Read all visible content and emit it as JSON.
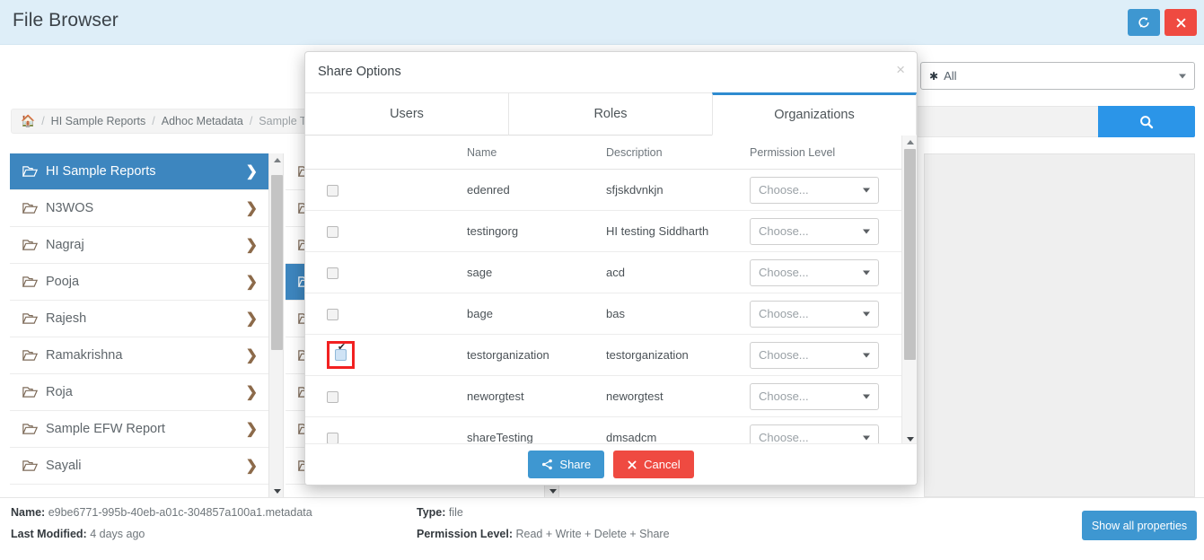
{
  "header": {
    "title": "File Browser",
    "refresh_icon": "refresh-icon",
    "close_icon": "close-icon",
    "accent_blue": "#3e97d1",
    "accent_red": "#ef4a41",
    "background": "#deeef8"
  },
  "breadcrumb": {
    "home_icon": "home-icon",
    "items": [
      "HI Sample Reports",
      "Adhoc Metadata",
      "Sample Travel M"
    ],
    "separator": "/"
  },
  "filter": {
    "icon": "asterisk-icon",
    "value": "All",
    "caret_icon": "chevron-down-icon"
  },
  "search": {
    "value": "",
    "placeholder": "",
    "button_icon": "search-icon"
  },
  "tree_column_1": {
    "items": [
      {
        "label": "HI Sample Reports",
        "active": true
      },
      {
        "label": "N3WOS",
        "active": false
      },
      {
        "label": "Nagraj",
        "active": false
      },
      {
        "label": "Pooja",
        "active": false
      },
      {
        "label": "Rajesh",
        "active": false
      },
      {
        "label": "Ramakrishna",
        "active": false
      },
      {
        "label": "Roja",
        "active": false
      },
      {
        "label": "Sample EFW Report",
        "active": false
      },
      {
        "label": "Sayali",
        "active": false
      }
    ],
    "folder_icon": "folder-icon",
    "chevron_icon": "chevron-right-icon"
  },
  "tree_column_2": {
    "items": [
      {
        "label": "",
        "active": false
      },
      {
        "label": "",
        "active": false
      },
      {
        "label": "",
        "active": false
      },
      {
        "label": "",
        "active": true
      },
      {
        "label": "",
        "active": false
      },
      {
        "label": "",
        "active": false
      },
      {
        "label": "",
        "active": false
      },
      {
        "label": "",
        "active": false
      },
      {
        "label": "",
        "active": false
      }
    ]
  },
  "modal": {
    "title": "Share Options",
    "close_icon": "close-icon",
    "tabs": [
      {
        "label": "Users",
        "active": false
      },
      {
        "label": "Roles",
        "active": false
      },
      {
        "label": "Organizations",
        "active": true
      }
    ],
    "active_tab_color": "#2e8bd0",
    "table": {
      "columns": [
        "",
        "Name",
        "Description",
        "Permission Level"
      ],
      "rows": [
        {
          "checked": false,
          "highlighted": false,
          "name": "edenred",
          "description": "sfjskdvnkjn",
          "permission": "Choose..."
        },
        {
          "checked": false,
          "highlighted": false,
          "name": "testingorg",
          "description": "HI testing Siddharth",
          "permission": "Choose..."
        },
        {
          "checked": false,
          "highlighted": false,
          "name": "sage",
          "description": "acd",
          "permission": "Choose..."
        },
        {
          "checked": false,
          "highlighted": false,
          "name": "bage",
          "description": "bas",
          "permission": "Choose..."
        },
        {
          "checked": true,
          "highlighted": true,
          "name": "testorganization",
          "description": "testorganization",
          "permission": "Choose..."
        },
        {
          "checked": false,
          "highlighted": false,
          "name": "neworgtest",
          "description": "neworgtest",
          "permission": "Choose..."
        },
        {
          "checked": false,
          "highlighted": false,
          "name": "shareTesting",
          "description": "dmsadcm",
          "permission": "Choose..."
        }
      ],
      "highlight_color": "#f22121",
      "select_caret_icon": "chevron-down-icon"
    },
    "footer": {
      "share_label": "Share",
      "share_icon": "share-icon",
      "cancel_label": "Cancel",
      "cancel_icon": "x-icon"
    },
    "scrollbar": {
      "up_icon": "triangle-up-icon",
      "down_icon": "triangle-down-icon"
    }
  },
  "status_bar": {
    "name_label": "Name:",
    "name_value": "e9be6771-995b-40eb-a01c-304857a100a1.metadata",
    "modified_label": "Last Modified:",
    "modified_value": "4 days ago",
    "type_label": "Type:",
    "type_value": "file",
    "permission_label": "Permission Level:",
    "permission_value": "Read + Write + Delete + Share",
    "properties_button": "Show all properties"
  }
}
